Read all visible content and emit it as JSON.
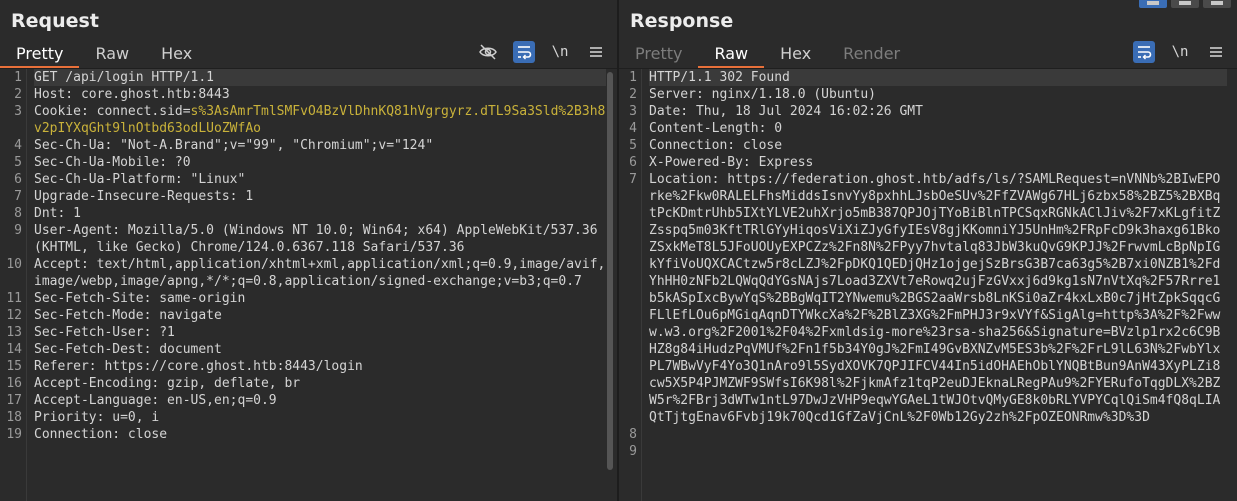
{
  "request": {
    "title": "Request",
    "tabs": [
      {
        "label": "Pretty",
        "state": "active"
      },
      {
        "label": "Raw",
        "state": "normal"
      },
      {
        "label": "Hex",
        "state": "normal"
      }
    ],
    "toolbar": {
      "newline_label": "\\n"
    },
    "lines": [
      {
        "n": "1",
        "text": "GET /api/login HTTP/1.1"
      },
      {
        "n": "2",
        "text": "Host: core.ghost.htb:8443"
      },
      {
        "n": "3",
        "cookie_key": "Cookie: ",
        "cookie_name": "connect.sid=",
        "cookie_value": "s%3AsAmrTmlSMFvO4BzVlDhnKQ81hVgrgyrz.dTL9Sa3Sld%2B3h8v2pIYXqGht9lnOtbd63odLUoZWfAo"
      },
      {
        "n": "4",
        "text": "Sec-Ch-Ua: \"Not-A.Brand\";v=\"99\", \"Chromium\";v=\"124\""
      },
      {
        "n": "5",
        "text": "Sec-Ch-Ua-Mobile: ?0"
      },
      {
        "n": "6",
        "text": "Sec-Ch-Ua-Platform: \"Linux\""
      },
      {
        "n": "7",
        "text": "Upgrade-Insecure-Requests: 1"
      },
      {
        "n": "8",
        "text": "Dnt: 1"
      },
      {
        "n": "9",
        "text": "User-Agent: Mozilla/5.0 (Windows NT 10.0; Win64; x64) AppleWebKit/537.36 (KHTML, like Gecko) Chrome/124.0.6367.118 Safari/537.36"
      },
      {
        "n": "10",
        "text": "Accept: text/html,application/xhtml+xml,application/xml;q=0.9,image/avif,image/webp,image/apng,*/*;q=0.8,application/signed-exchange;v=b3;q=0.7"
      },
      {
        "n": "11",
        "text": "Sec-Fetch-Site: same-origin"
      },
      {
        "n": "12",
        "text": "Sec-Fetch-Mode: navigate"
      },
      {
        "n": "13",
        "text": "Sec-Fetch-User: ?1"
      },
      {
        "n": "14",
        "text": "Sec-Fetch-Dest: document"
      },
      {
        "n": "15",
        "text": "Referer: https://core.ghost.htb:8443/login"
      },
      {
        "n": "16",
        "text": "Accept-Encoding: gzip, deflate, br"
      },
      {
        "n": "17",
        "text": "Accept-Language: en-US,en;q=0.9"
      },
      {
        "n": "18",
        "text": "Priority: u=0, i"
      },
      {
        "n": "19",
        "text": "Connection: close"
      }
    ]
  },
  "response": {
    "title": "Response",
    "tabs": [
      {
        "label": "Pretty",
        "state": "disabled"
      },
      {
        "label": "Raw",
        "state": "active"
      },
      {
        "label": "Hex",
        "state": "normal"
      },
      {
        "label": "Render",
        "state": "disabled"
      }
    ],
    "toolbar": {
      "newline_label": "\\n"
    },
    "lines": [
      {
        "n": "1",
        "text": "HTTP/1.1 302 Found"
      },
      {
        "n": "2",
        "text": "Server: nginx/1.18.0 (Ubuntu)"
      },
      {
        "n": "3",
        "text": "Date: Thu, 18 Jul 2024 16:02:26 GMT"
      },
      {
        "n": "4",
        "text": "Content-Length: 0"
      },
      {
        "n": "5",
        "text": "Connection: close"
      },
      {
        "n": "6",
        "text": "X-Powered-By: Express"
      },
      {
        "n": "7",
        "text": "Location: https://federation.ghost.htb/adfs/ls/?SAMLRequest=nVNNb%2BIwEPOrke%2Fkw0RALELFhsMiddsIsnvYy8pxhhLJsbOeSUv%2FfZVAWg67HLj6zbx58%2BZ5%2BXBqtPcKDmtrUhb5IXtYLVE2uhXrjo5mB387QPJOjTYoBiBlnTPCSqxRGNkAClJiv%2F7xKLgfitZZsspq5m03KftTRlGYyHiqosViXiZJyGfyIEsV8gjKKomniYJ5UnHm%2FRpFcD9k3haxg61BkoZSxkMeT8L5JFoUOUyEXPCZz%2Fn8N%2FPyy7hvtalq83JbW3kuQvG9KPJJ%2FrwvmLcBpNpIGkYfiVoUQXCACtzw5r8cLZJ%2FpDKQ1QEDjQHz1ojgejSzBrsG3B7ca63g5%2B7xi0NZB1%2FdYhHH0zNFb2LQWqQdYGsNAjs7Load3ZXVt7eRowq2ujFzGVxxj6d9kg1sN7nVtXq%2F57Rrre1b5kASpIxcBywYqS%2BBgWqIT2YNwemu%2BGS2aaWrsb8LnKSi0aZr4kxLxB0c7jHtZpkSqqcGFLlEfLOu6pMGiqAqnDTYWkcXa%2F%2BlZ3XG%2FmPHJ3r9xVYf&SigAlg=http%3A%2F%2Fwww.w3.org%2F2001%2F04%2Fxmldsig-more%23rsa-sha256&Signature=BVzlp1rx2c6C9BHZ8g84iHudzPqVMUf%2Fn1f5b34Y0gJ%2FmI49GvBXNZvM5ES3b%2F%2FrL9lL63N%2FwbYlxPL7WBwVyF4Yo3Q1nAro9l5SydXOVK7QPJIFCV44In5idOHAEhOblYNQBtBun9AnW43XyPLZi8cw5X5P4PJMZWF9SWfsI6K98l%2FjkmAfz1tqP2euDJEknaLRegPAu9%2FYERufoTqgDLX%2BZW5r%2FBrj3dWTw1ntL97DwJzVHP9eqwYGAeL1tWJOtvQMyGE8k0bRLYVPYCqlQiSm4fQ8qLIAQtTjtgEnav6Fvbj19k70Qcd1GfZaVjCnL%2F0Wb12Gy2zh%2FpOZEONRmw%3D%3D"
      },
      {
        "n": "8",
        "text": ""
      },
      {
        "n": "9",
        "text": ""
      }
    ]
  }
}
